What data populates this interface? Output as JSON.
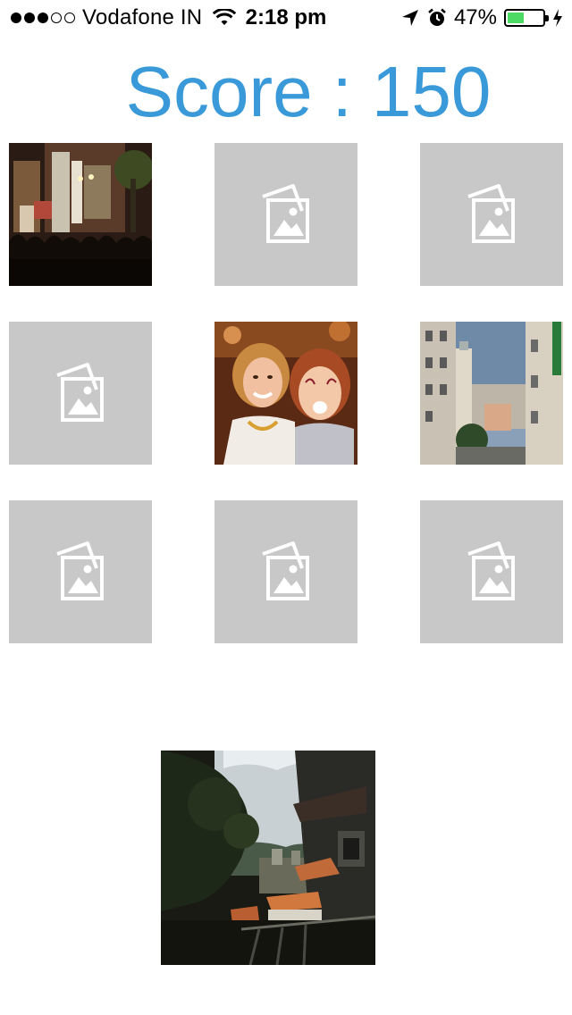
{
  "status_bar": {
    "carrier": "Vodafone IN",
    "time": "2:18 pm",
    "battery_percent": "47%",
    "battery_level": 0.47,
    "battery_color": "#4cd964",
    "signal_bars_filled": 3,
    "signal_bars_total": 5
  },
  "score": {
    "label": "Score",
    "separator": ":",
    "value": "150",
    "color": "#3a9ad9"
  },
  "grid": {
    "placeholder_color": "#c8c8c8",
    "tiles": [
      {
        "state": "revealed",
        "image": "concert-stage-photo"
      },
      {
        "state": "hidden",
        "icon": "image-placeholder-icon"
      },
      {
        "state": "hidden",
        "icon": "image-placeholder-icon"
      },
      {
        "state": "hidden",
        "icon": "image-placeholder-icon"
      },
      {
        "state": "revealed",
        "image": "two-women-face-paint-photo"
      },
      {
        "state": "revealed",
        "image": "paris-street-photo"
      },
      {
        "state": "hidden",
        "icon": "image-placeholder-icon"
      },
      {
        "state": "hidden",
        "icon": "image-placeholder-icon"
      },
      {
        "state": "hidden",
        "icon": "image-placeholder-icon"
      }
    ]
  },
  "target_image": {
    "image": "temple-hillside-view-photo"
  }
}
